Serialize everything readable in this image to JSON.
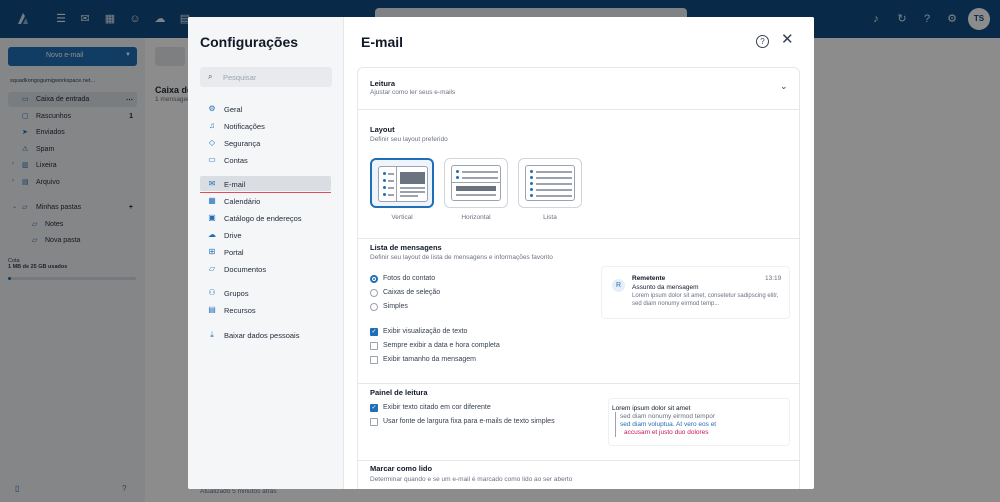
{
  "app": {
    "avatar_initials": "TS",
    "new_mail_label": "Novo e-mail",
    "account": "squadkongogumigworkspace.net...",
    "folders": [
      {
        "label": "Caixa de entrada",
        "icon": "inbox-icon",
        "count": ""
      },
      {
        "label": "Rascunhos",
        "icon": "draft-icon",
        "count": "1"
      },
      {
        "label": "Enviados",
        "icon": "send-icon",
        "count": ""
      },
      {
        "label": "Spam",
        "icon": "spam-icon",
        "count": ""
      },
      {
        "label": "Lixeira",
        "icon": "trash-icon",
        "count": ""
      },
      {
        "label": "Arquivo",
        "icon": "archive-icon",
        "count": ""
      },
      {
        "label": "Minhas pastas",
        "icon": "folder-icon",
        "count": ""
      },
      {
        "label": "Notes",
        "icon": "folder-icon",
        "count": ""
      },
      {
        "label": "Nova pasta",
        "icon": "folder-icon",
        "count": ""
      }
    ],
    "quota_label": "Cota",
    "quota_text": "1 MB de 25 GB usados",
    "quota_fraction": 0.02,
    "list_title": "Caixa de",
    "list_sub": "1 mensagem",
    "status_text": "Atualizado 5 minutos atrás",
    "brand_color": "#0f4c81"
  },
  "settings": {
    "title": "Configurações",
    "search_placeholder": "Pesquisar",
    "nav": [
      {
        "label": "Geral",
        "icon": "gear-icon"
      },
      {
        "label": "Notificações",
        "icon": "bell-icon"
      },
      {
        "label": "Segurança",
        "icon": "shield-icon"
      },
      {
        "label": "Contas",
        "icon": "accounts-icon"
      },
      {
        "label": "E-mail",
        "icon": "mail-icon"
      },
      {
        "label": "Calendário",
        "icon": "calendar-icon"
      },
      {
        "label": "Catálogo de endereços",
        "icon": "address-book-icon"
      },
      {
        "label": "Drive",
        "icon": "cloud-icon"
      },
      {
        "label": "Portal",
        "icon": "portal-icon"
      },
      {
        "label": "Documentos",
        "icon": "documents-icon"
      },
      {
        "label": "Grupos",
        "icon": "groups-icon"
      },
      {
        "label": "Recursos",
        "icon": "resources-icon"
      },
      {
        "label": "Baixar dados pessoais",
        "icon": "download-icon"
      }
    ],
    "active_nav": "E-mail",
    "section_title": "E-mail",
    "leitura": {
      "title": "Leitura",
      "subtitle": "Ajustar como ler seus e-mails"
    },
    "layout": {
      "title": "Layout",
      "subtitle": "Definir seu layout preferido",
      "options": [
        "Vertical",
        "Horizontal",
        "Lista"
      ],
      "selected": "Vertical"
    },
    "message_list": {
      "title": "Lista de mensagens",
      "subtitle": "Definir seu layout de lista de mensagens e informações favorito",
      "radios": [
        "Fotos do contato",
        "Caixas de seleção",
        "Simples"
      ],
      "selected_radio": "Fotos do contato",
      "checks": [
        {
          "label": "Exibir visualização de texto",
          "checked": true
        },
        {
          "label": "Sempre exibir a data e hora completa",
          "checked": false
        },
        {
          "label": "Exibir tamanho da mensagem",
          "checked": false
        }
      ],
      "preview": {
        "avatar": "R",
        "from": "Remetente",
        "time": "13:19",
        "subject": "Assunto da mensagem",
        "body": "Lorem ipsum dolor sit amet, consetetur sadipscing elitr, sed diam nonumy eirmod temp..."
      }
    },
    "reading_pane": {
      "title": "Painel de leitura",
      "checks": [
        {
          "label": "Exibir texto citado em cor diferente",
          "checked": true
        },
        {
          "label": "Usar fonte de largura fixa para e-mails de texto simples",
          "checked": false
        }
      ],
      "quote_lines": [
        "Lorem ipsum dolor sit amet",
        "sed diam nonumy eirmod tempor",
        "sed diam voluptua. At vero eos et",
        "accusam et justo duo dolores"
      ]
    },
    "mark_read": {
      "title": "Marcar como lido",
      "subtitle": "Determinar quando e se um e-mail é marcado como lido ao ser aberto"
    }
  }
}
